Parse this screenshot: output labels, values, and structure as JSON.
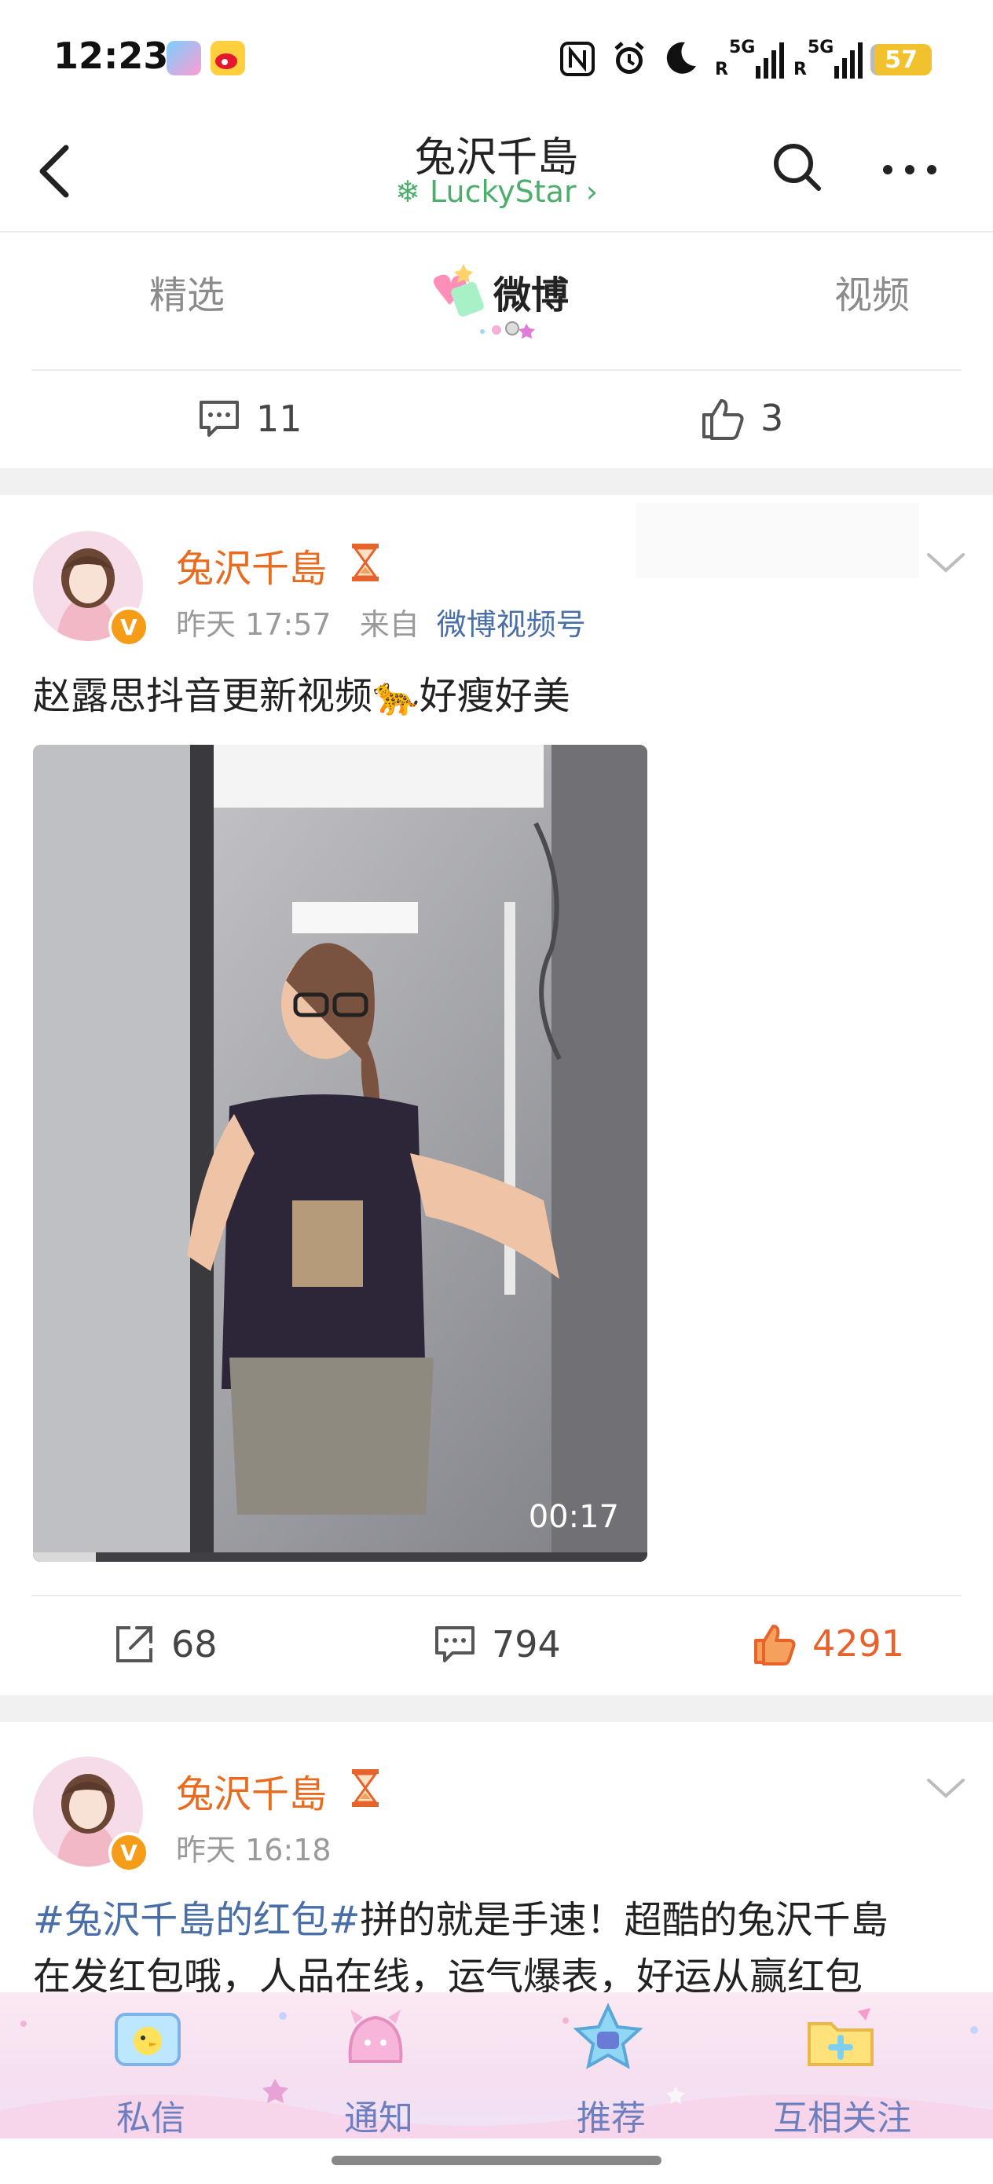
{
  "status_bar": {
    "time": "12:23",
    "network1": "5G",
    "network2": "5G",
    "battery": "57"
  },
  "header": {
    "title": "兔沢千島",
    "subtitle": "LuckyStar",
    "subtitle_chevron": "›"
  },
  "tabs": [
    {
      "label": "精选"
    },
    {
      "label": "微博"
    },
    {
      "label": "视频"
    }
  ],
  "top_card": {
    "comments": "11",
    "likes": "3"
  },
  "posts": [
    {
      "author": "兔沢千島",
      "time": "昨天 17:57",
      "from_label": "来自",
      "source": "微博视频号",
      "text": "赵露思抖音更新视频🐆好瘦好美",
      "video_duration": "00:17",
      "shares": "68",
      "comments": "794",
      "likes": "4291"
    },
    {
      "author": "兔沢千島",
      "time": "昨天 16:18",
      "topic": "#兔沢千島的红包#",
      "text_after_topic": "拼的就是手速！超酷的兔沢千島",
      "text_line2": "在发红包哦，人品在线，运气爆表，好运从赢红包"
    }
  ],
  "bottom_nav": [
    {
      "label": "私信",
      "icon": "message-icon"
    },
    {
      "label": "通知",
      "icon": "bell-icon"
    },
    {
      "label": "推荐",
      "icon": "star-icon"
    },
    {
      "label": "互相关注",
      "icon": "folder-plus-icon"
    }
  ],
  "colors": {
    "accent_orange": "#e86b1f",
    "link_blue": "#4a6ea8",
    "like_active": "#e8632b",
    "lucky_green": "#4cae6c"
  }
}
